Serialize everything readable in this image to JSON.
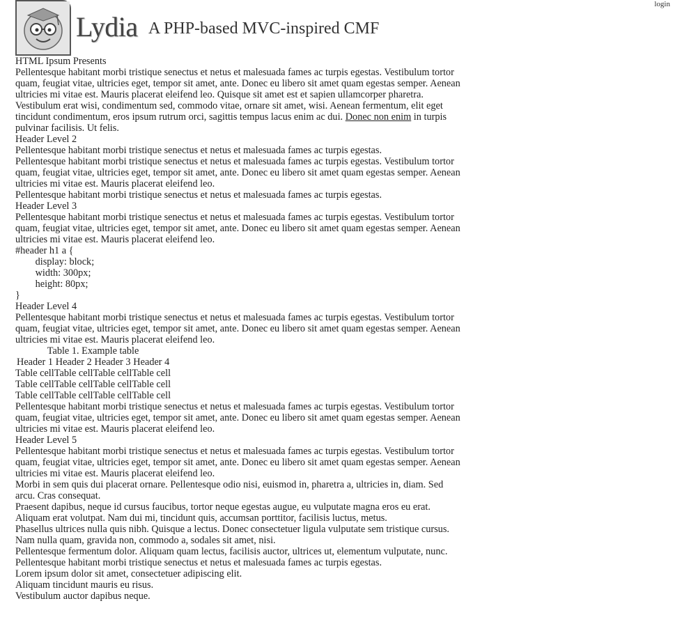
{
  "nav": {
    "login": "login"
  },
  "header": {
    "title": "Lydia",
    "slogan": "A PHP-based MVC-inspired CMF"
  },
  "content": {
    "h1": "HTML Ipsum Presents",
    "p1_text": "Pellentesque habitant morbi tristique senectus et netus et malesuada fames ac turpis egestas. Vestibulum tortor quam, feugiat vitae, ultricies eget, tempor sit amet, ante. Donec eu libero sit amet quam egestas semper. Aenean ultricies mi vitae est. Mauris placerat eleifend leo. Quisque sit amet est et sapien ullamcorper pharetra. Vestibulum erat wisi, condimentum sed, commodo vitae, ornare sit amet, wisi. Aenean fermentum, elit eget tincidunt condimentum, eros ipsum rutrum orci, sagittis tempus lacus enim ac dui.",
    "p1_link": "Donec non enim",
    "p1_tail": "in turpis pulvinar facilisis. Ut felis.",
    "h2": "Header Level 2",
    "list2": [
      "Pellentesque habitant morbi tristique senectus et netus et malesuada fames ac turpis egestas.",
      "Pellentesque habitant morbi tristique senectus et netus et malesuada fames ac turpis egestas. Vestibulum tortor quam, feugiat vitae, ultricies eget, tempor sit amet, ante. Donec eu libero sit amet quam egestas semper. Aenean ultricies mi vitae est. Mauris placerat eleifend leo.",
      "Pellentesque habitant morbi tristique senectus et netus et malesuada fames ac turpis egestas."
    ],
    "h3": "Header Level 3",
    "list3": [
      "Pellentesque habitant morbi tristique senectus et netus et malesuada fames ac turpis egestas. Vestibulum tortor quam, feugiat vitae, ultricies eget, tempor sit amet, ante. Donec eu libero sit amet quam egestas semper. Aenean ultricies mi vitae est. Mauris placerat eleifend leo."
    ],
    "code_lines": [
      "#header h1 a {",
      "        display: block;",
      "        width: 300px;",
      "        height: 80px;",
      "}"
    ],
    "h4": "Header Level 4",
    "p4": "Pellentesque habitant morbi tristique senectus et netus et malesuada fames ac turpis egestas. Vestibulum tortor quam, feugiat vitae, ultricies eget, tempor sit amet, ante. Donec eu libero sit amet quam egestas semper. Aenean ultricies mi vitae est. Mauris placerat eleifend leo.",
    "table": {
      "caption": "Table 1. Example table",
      "headers": [
        "Header 1",
        "Header 2",
        "Header 3",
        "Header 4"
      ],
      "rows": [
        [
          "Table cell",
          "Table cell",
          "Table cell",
          "Table cell"
        ],
        [
          "Table cell",
          "Table cell",
          "Table cell",
          "Table cell"
        ],
        [
          "Table cell",
          "Table cell",
          "Table cell",
          "Table cell"
        ]
      ]
    },
    "p_after_table": "Pellentesque habitant morbi tristique senectus et netus et malesuada fames ac turpis egestas. Vestibulum tortor quam, feugiat vitae, ultricies eget, tempor sit amet, ante. Donec eu libero sit amet quam egestas semper. Aenean ultricies mi vitae est. Mauris placerat eleifend leo.",
    "h5": "Header Level 5",
    "list5": [
      "Pellentesque habitant morbi tristique senectus et netus et malesuada fames ac turpis egestas. Vestibulum tortor quam, feugiat vitae, ultricies eget, tempor sit amet, ante. Donec eu libero sit amet quam egestas semper. Aenean ultricies mi vitae est. Mauris placerat eleifend leo.",
      "Morbi in sem quis dui placerat ornare. Pellentesque odio nisi, euismod in, pharetra a, ultricies in, diam. Sed arcu. Cras consequat.",
      "Praesent dapibus, neque id cursus faucibus, tortor neque egestas augue, eu vulputate magna eros eu erat. Aliquam erat volutpat. Nam dui mi, tincidunt quis, accumsan porttitor, facilisis luctus, metus.",
      "Phasellus ultrices nulla quis nibh. Quisque a lectus. Donec consectetuer ligula vulputate sem tristique cursus. Nam nulla quam, gravida non, commodo a, sodales sit amet, nisi.",
      "Pellentesque fermentum dolor. Aliquam quam lectus, facilisis auctor, ultrices ut, elementum vulputate, nunc.",
      "Pellentesque habitant morbi tristique senectus et netus et malesuada fames ac turpis egestas."
    ],
    "list_tail": [
      "Lorem ipsum dolor sit amet, consectetuer adipiscing elit.",
      "Aliquam tincidunt mauris eu risus.",
      "Vestibulum auctor dapibus neque."
    ]
  }
}
